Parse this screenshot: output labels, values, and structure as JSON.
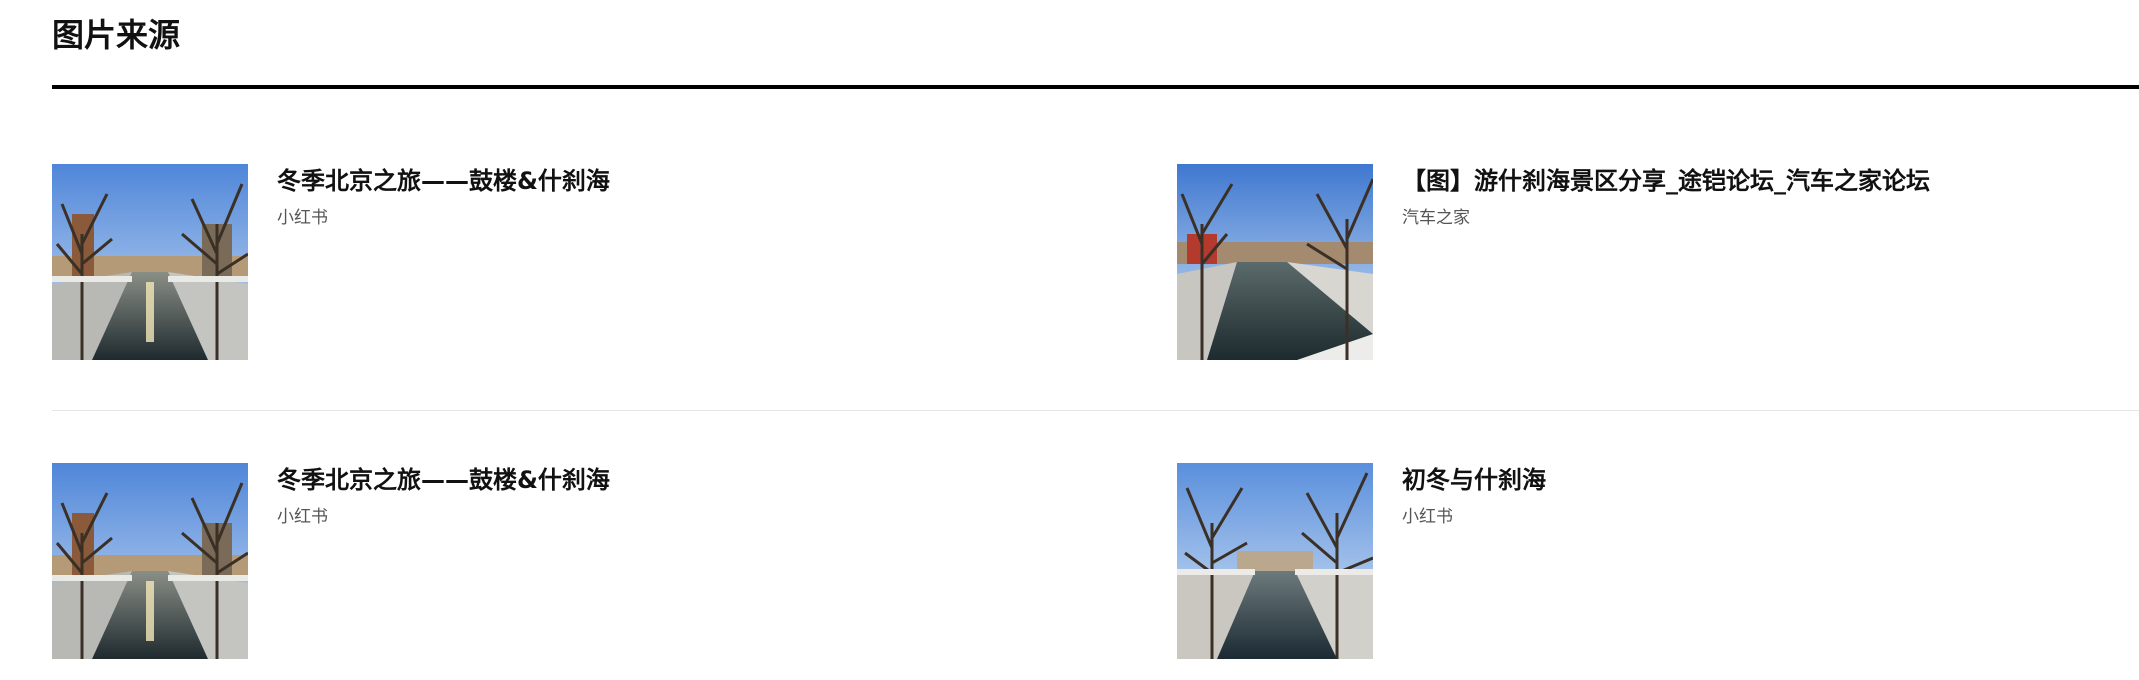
{
  "section": {
    "title": "图片来源"
  },
  "results": [
    {
      "title": "冬季北京之旅——鼓楼&什刹海",
      "source": "小红书"
    },
    {
      "title": "【图】游什刹海景区分享_途铠论坛_汽车之家论坛",
      "source": "汽车之家"
    },
    {
      "title": "冬季北京之旅——鼓楼&什刹海",
      "source": "小红书"
    },
    {
      "title": "初冬与什刹海",
      "source": "小红书"
    }
  ]
}
